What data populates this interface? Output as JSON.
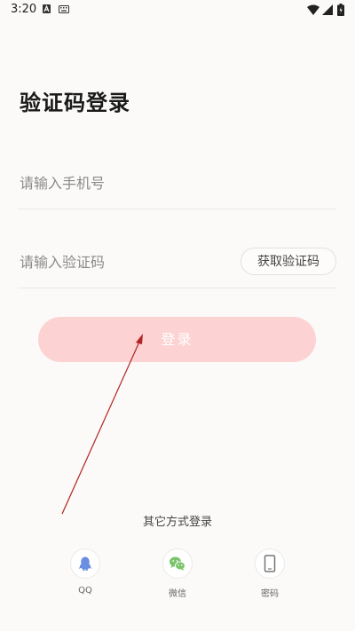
{
  "status_bar": {
    "time": "3:20",
    "left_icons": [
      "a-notification-icon",
      "keyboard-icon"
    ],
    "right_icons": [
      "wifi-icon",
      "signal-icon",
      "battery-icon"
    ]
  },
  "title": "验证码登录",
  "phone": {
    "placeholder": "请输入手机号",
    "value": ""
  },
  "code": {
    "placeholder": "请输入验证码",
    "value": "",
    "get_code_label": "获取验证码"
  },
  "login_label": "登录",
  "other_methods": {
    "label": "其它方式登录",
    "items": [
      {
        "label": "QQ",
        "icon": "qq-icon",
        "color": "#6b8fe0"
      },
      {
        "label": "微信",
        "icon": "wechat-icon",
        "color": "#7bc46a"
      },
      {
        "label": "密码",
        "icon": "phone-icon",
        "color": "#777777"
      }
    ]
  },
  "colors": {
    "login_button": "#fcd2d2",
    "background": "#fbfaf8",
    "annotation_arrow": "#b22222"
  }
}
